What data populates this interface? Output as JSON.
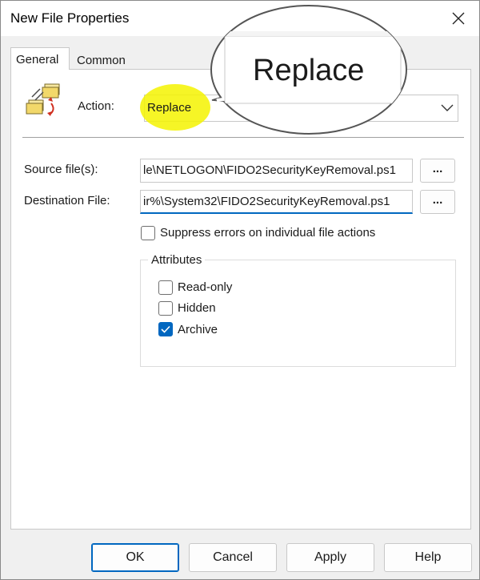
{
  "window": {
    "title": "New File Properties"
  },
  "tabs": [
    {
      "label": "General",
      "active": true
    },
    {
      "label": "Common",
      "active": false
    }
  ],
  "action": {
    "label": "Action:",
    "selected": "Replace",
    "icon": "file-copy-icon"
  },
  "fields": {
    "source": {
      "label": "Source file(s):",
      "value": "le\\NETLOGON\\FIDO2SecurityKeyRemoval.ps1",
      "browse_label": "..."
    },
    "destination": {
      "label": "Destination File:",
      "value": "ir%\\System32\\FIDO2SecurityKeyRemoval.ps1",
      "browse_label": "..."
    }
  },
  "suppress": {
    "label": "Suppress errors on individual file actions",
    "checked": false
  },
  "attributes": {
    "title": "Attributes",
    "items": [
      {
        "label": "Read-only",
        "checked": false
      },
      {
        "label": "Hidden",
        "checked": false
      },
      {
        "label": "Archive",
        "checked": true
      }
    ]
  },
  "buttons": {
    "ok": "OK",
    "cancel": "Cancel",
    "apply": "Apply",
    "help": "Help"
  },
  "callout": {
    "text": "Replace"
  },
  "colors": {
    "accent": "#0067c0",
    "highlight": "#f4f300"
  }
}
